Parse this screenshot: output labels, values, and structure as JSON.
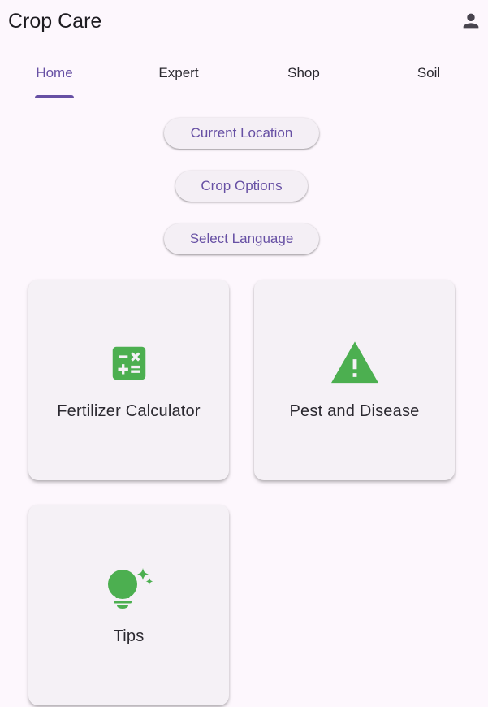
{
  "app": {
    "title": "Crop Care",
    "account_icon": "person-icon"
  },
  "tabs": [
    {
      "label": "Home",
      "selected": true
    },
    {
      "label": "Expert",
      "selected": false
    },
    {
      "label": "Shop",
      "selected": false
    },
    {
      "label": "Soil",
      "selected": false
    }
  ],
  "actions": {
    "current_location": "Current Location",
    "crop_options": "Crop Options",
    "select_language": "Select Language"
  },
  "cards": [
    {
      "label": "Fertilizer Calculator",
      "icon": "calculator-icon"
    },
    {
      "label": "Pest and Disease",
      "icon": "warning-icon"
    },
    {
      "label": "Tips",
      "icon": "lightbulb-icon"
    }
  ],
  "colors": {
    "accent": "#6750a4",
    "icon_green": "#4caf50",
    "background": "#fdf7fd"
  }
}
